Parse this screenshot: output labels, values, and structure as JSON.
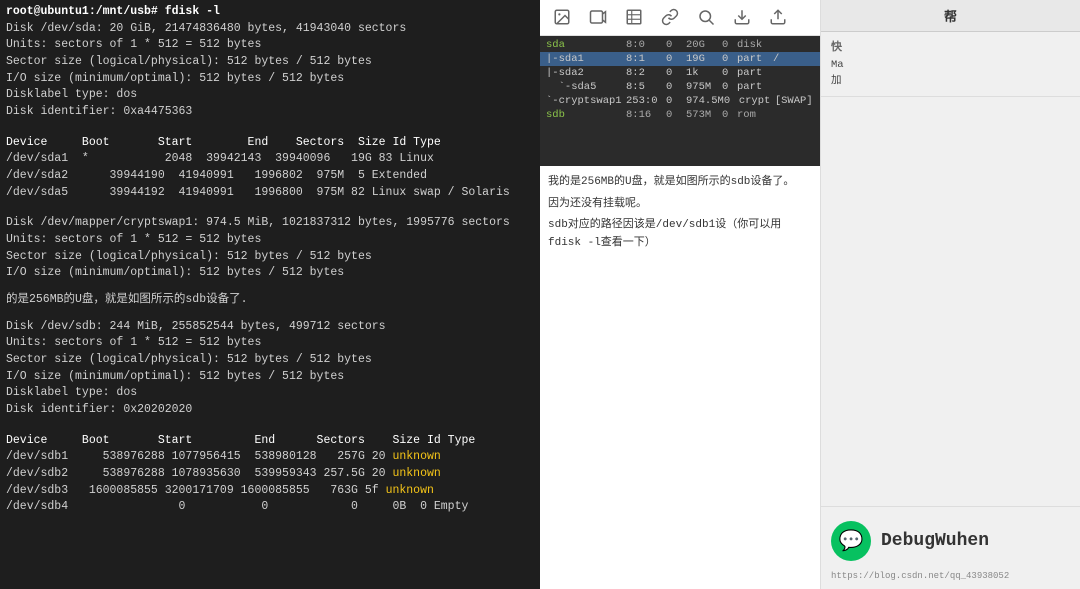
{
  "terminal": {
    "cmd_line": "root@ubuntu1:/mnt/usb# fdisk -l",
    "sda_info": [
      "Disk /dev/sda: 20 GiB, 21474836480 bytes, 41943040 sectors",
      "Units: sectors of 1 * 512 = 512 bytes",
      "Sector size (logical/physical): 512 bytes / 512 bytes",
      "I/O size (minimum/optimal): 512 bytes / 512 bytes",
      "Disklabel type: dos",
      "Disk identifier: 0xa4475363"
    ],
    "sda_header": "Device      Boot       Start        End    Sectors  Size Id Type",
    "sda_rows": [
      {
        "dev": "/dev/sda1",
        "boot": "*",
        "start": "2048",
        "end": "39942143",
        "sectors": "39940096",
        "size": "19G",
        "id": "83",
        "type": "Linux",
        "unknown": false
      },
      {
        "dev": "/dev/sda2",
        "boot": "",
        "start": "39944190",
        "end": "41940991",
        "sectors": "1996802",
        "size": "975M",
        "id": "5",
        "type": "Extended",
        "unknown": false
      },
      {
        "dev": "/dev/sda5",
        "boot": "",
        "start": "39944192",
        "end": "41940991",
        "sectors": "1996800",
        "size": "975M",
        "id": "82",
        "type": "Linux swap / Solaris",
        "unknown": false
      }
    ],
    "cryptswap_info": [
      "Disk /dev/mapper/cryptswap1: 974.5 MiB, 1021837312 bytes, 1995776 sectors",
      "Units: sectors of 1 * 512 = 512 bytes",
      "Sector size (logical/physical): 512 bytes / 512 bytes",
      "I/O size (minimum/optimal): 512 bytes / 512 bytes"
    ],
    "note1": "的是256MB的U盘，就是如图所示的sdb设备了.",
    "sdb_info": [
      "Disk /dev/sdb: 244 MiB, 255852544 bytes, 499712 sectors",
      "Units: sectors of 1 * 512 = 512 bytes",
      "Sector size (logical/physical): 512 bytes / 512 bytes",
      "I/O size (minimum/optimal): 512 bytes / 512 bytes",
      "Disklabel type: dos",
      "Disk identifier: 0x20202020"
    ],
    "sdb_header": "Device      Boot       Start        End      Sectors    Size Id Type",
    "sdb_rows": [
      {
        "dev": "/dev/sdb1",
        "boot": "",
        "start": "538976288",
        "end": "1077956415",
        "sectors": "538980128",
        "size": "257G",
        "id": "20",
        "type": "unknown",
        "unknown": true
      },
      {
        "dev": "/dev/sdb2",
        "boot": "",
        "start": "538976288",
        "end": "1078935630",
        "sectors": "539959343",
        "size": "257.5G",
        "id": "20",
        "type": "unknown",
        "unknown": true
      },
      {
        "dev": "/dev/sdb3",
        "boot": "",
        "start": "1600085855",
        "end": "3200171709",
        "sectors": "1600085855",
        "size": "763G",
        "id": "5f",
        "type": "unknown",
        "unknown": true
      },
      {
        "dev": "/dev/sdb4",
        "boot": "",
        "start": "0",
        "end": "0",
        "sectors": "0",
        "size": "0B",
        "id": "0",
        "type": "Empty",
        "unknown": false
      }
    ]
  },
  "file_manager": {
    "rows": [
      {
        "name": "sda",
        "cols": [
          "8:0",
          "0",
          "20G",
          "0",
          "disk",
          ""
        ],
        "selected": false
      },
      {
        "name": "|-sda1",
        "cols": [
          "8:1",
          "0",
          "19G",
          "0",
          "part",
          "/"
        ],
        "selected": true
      },
      {
        "name": "|-sda2",
        "cols": [
          "8:2",
          "0",
          "1k",
          "0",
          "part",
          ""
        ],
        "selected": false
      },
      {
        "name": "  `-sda5",
        "cols": [
          "8:5",
          "0",
          "975M",
          "0",
          "part",
          ""
        ],
        "selected": false
      },
      {
        "name": "|-cryptswap1",
        "cols": [
          "253:0",
          "0",
          "974.5M",
          "0",
          "crypt",
          "[SWAP]"
        ],
        "selected": false
      },
      {
        "name": "sdb",
        "cols": [
          "8:16",
          "0",
          "573M",
          "0",
          "rom",
          ""
        ],
        "selected": false
      }
    ]
  },
  "text_content": {
    "para1": "我的是256MB的U盘，就是如图所示的sdb设备了。",
    "para2": "因为还没有挂载呢。",
    "para3": "sdb对应的路径因该是/dev/sdb1设（你可以用fdisk -l查看一下）"
  },
  "sidebar": {
    "title": "帮",
    "sections": [
      {
        "title": "快",
        "items": [
          "Ma",
          "加",
          ""
        ]
      }
    ]
  },
  "brand": {
    "icon": "💬",
    "name": "DebugWuhen",
    "url": "https://blog.csdn.net/qq_43938052"
  }
}
